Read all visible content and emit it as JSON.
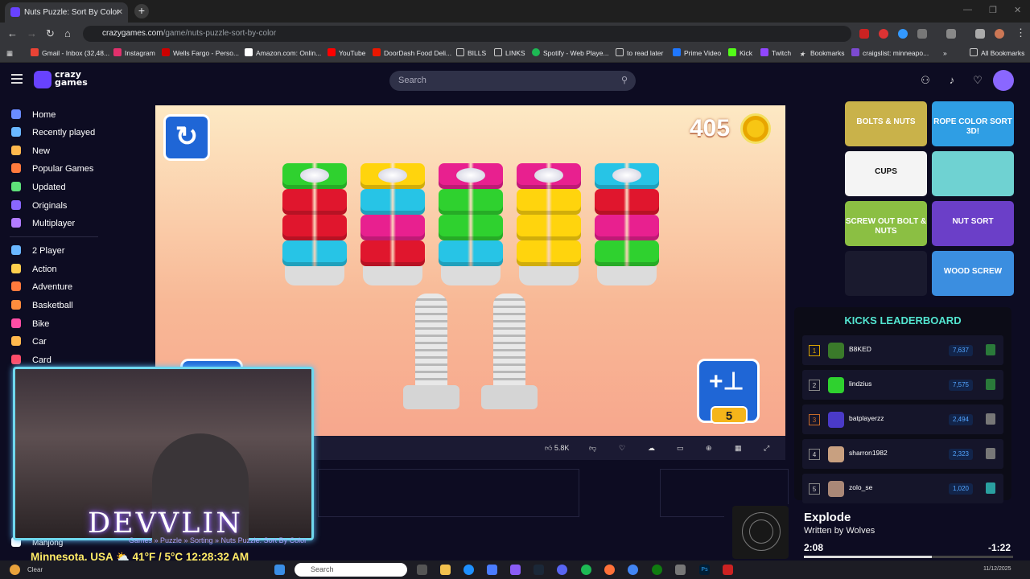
{
  "browser": {
    "tab_title": "Nuts Puzzle: Sort By Color",
    "url_domain": "crazygames.com",
    "url_path": "/game/nuts-puzzle-sort-by-color",
    "bookmarks": [
      "Gmail - Inbox (32,48...",
      "Instagram",
      "Wells Fargo - Perso...",
      "Amazon.com: Onlin...",
      "YouTube",
      "DoorDash Food Deli...",
      "BILLS",
      "LINKS",
      "Spotify - Web Playe...",
      "to read later",
      "Prime Video",
      "Kick",
      "Twitch",
      "Bookmarks",
      "craigslist: minneapo..."
    ],
    "all_bookmarks": "All Bookmarks"
  },
  "site": {
    "logo_line1": "crazy",
    "logo_line2": "games",
    "search_placeholder": "Search"
  },
  "sidebar": {
    "primary": [
      "Home",
      "Recently played",
      "New",
      "Popular Games",
      "Updated",
      "Originals",
      "Multiplayer"
    ],
    "categories": [
      "2 Player",
      "Action",
      "Adventure",
      "Basketball",
      "Bike",
      "Car",
      "Card",
      "Mahjong"
    ],
    "icon_colors": [
      "#6a8cff",
      "#6ab7ff",
      "#ffb84d",
      "#ff7a3d",
      "#5ee07a",
      "#8a67ff",
      "#b27cff",
      "#6ab7ff",
      "#ffcf4d",
      "#ff7a3d",
      "#ff8d3d",
      "#ff4da6",
      "#ffb84d",
      "#ff4d6a",
      "#ffffff"
    ]
  },
  "game": {
    "coins": "405",
    "add_pin_count": "5",
    "colors": {
      "green": "#2fd12f",
      "red": "#e0162d",
      "cyan": "#27c4e6",
      "yellow": "#ffd40d",
      "pink": "#e8208f",
      "gray": "#dcdcdc"
    },
    "columns": [
      [
        "green",
        "red",
        "red",
        "cyan"
      ],
      [
        "yellow",
        "cyan",
        "pink",
        "red"
      ],
      [
        "pink",
        "green",
        "green",
        "cyan"
      ],
      [
        "pink",
        "yellow",
        "yellow",
        "yellow"
      ],
      [
        "cyan",
        "red",
        "pink",
        "green"
      ]
    ]
  },
  "game_bar": {
    "likes": "5.8K"
  },
  "breadcrumbs": "Games » Puzzle » Sorting » Nuts Puzzle: Sort By Color",
  "thumbnails": [
    {
      "label": "BOLTS & NUTS",
      "color": "#c9b24a"
    },
    {
      "label": "ROPE COLOR SORT 3D!",
      "color": "#2f9ee4"
    },
    {
      "label": "CUPS",
      "color": "#f4f4f4"
    },
    {
      "label": "",
      "color": "#6fd2d2"
    },
    {
      "label": "SCREW OUT BOLT & NUTS",
      "color": "#8bbf43"
    },
    {
      "label": "NUT SORT",
      "color": "#6b3fc8"
    },
    {
      "label": "",
      "color": "#1a1a2e"
    },
    {
      "label": "WOOD SCREW",
      "color": "#3b8ee0"
    }
  ],
  "leaderboard": {
    "title": "KICKS LEADERBOARD",
    "rows": [
      {
        "rank": "1",
        "name": "B8KED",
        "score": "7,637",
        "avatar": "#3a7a2a",
        "badge": "#2a7a3a"
      },
      {
        "rank": "2",
        "name": "lindzius",
        "score": "7,575",
        "avatar": "#2fd12f",
        "badge": "#2a7a3a"
      },
      {
        "rank": "3",
        "name": "batplayerzz",
        "score": "2,494",
        "avatar": "#4a3ac8",
        "badge": "#777777"
      },
      {
        "rank": "4",
        "name": "sharron1982",
        "score": "2,323",
        "avatar": "#c8a080",
        "badge": "#777777"
      },
      {
        "rank": "5",
        "name": "zolo_se",
        "score": "1,020",
        "avatar": "#aa8877",
        "badge": "#2aa0a0"
      }
    ]
  },
  "stream": {
    "name": "DEVVLIN",
    "weather": "Minnesota, USA ⛅ 41°F / 5°C  12:28:32 AM"
  },
  "music": {
    "song": "Explode",
    "artist": "Written by Wolves",
    "current": "2:08",
    "remaining": "-1:22",
    "progress": 0.61
  },
  "taskbar": {
    "search": "Search",
    "weather": "Clear",
    "date": "11/12/2025"
  }
}
